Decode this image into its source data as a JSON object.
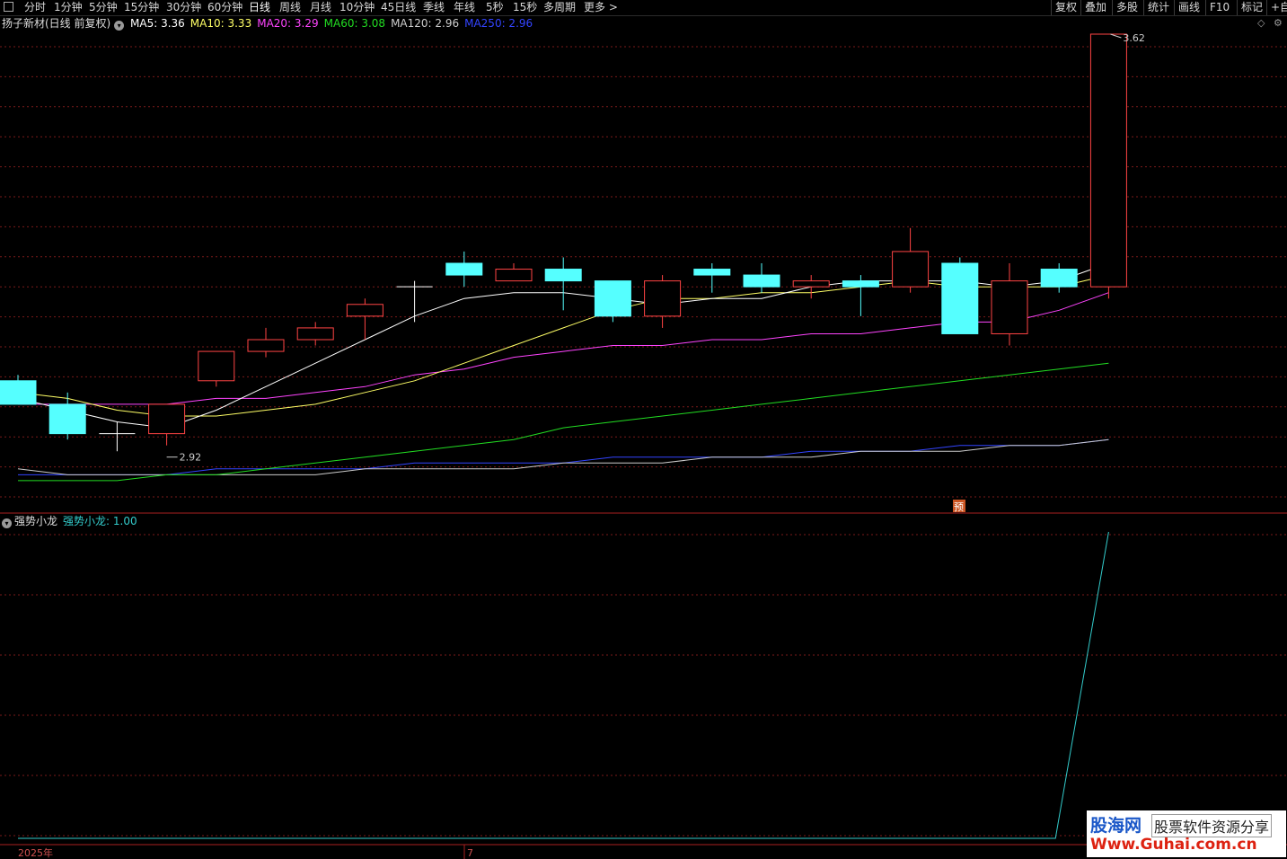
{
  "toolbar": {
    "periods": [
      "分时",
      "1分钟",
      "5分钟",
      "15分钟",
      "30分钟",
      "60分钟",
      "日线",
      "周线",
      "月线",
      "10分钟",
      "45日线",
      "季线",
      "年线",
      "5秒",
      "15秒",
      "多周期",
      "更多 >"
    ],
    "active": "日线",
    "right": [
      "复权",
      "叠加",
      "多股",
      "统计",
      "画线",
      "F10",
      "标记",
      "+自"
    ]
  },
  "main_legend": {
    "title": "扬子新材(日线 前复权)",
    "ma": [
      {
        "label": "MA5: 3.36",
        "color": "#ffffff"
      },
      {
        "label": "MA10: 3.33",
        "color": "#ffff66"
      },
      {
        "label": "MA20: 3.29",
        "color": "#ff44ff"
      },
      {
        "label": "MA60: 3.08",
        "color": "#22dd22"
      },
      {
        "label": "MA120: 2.96",
        "color": "#cccccc"
      },
      {
        "label": "MA250: 2.96",
        "color": "#3344ff"
      }
    ]
  },
  "indicator_legend": {
    "title": "强势小龙",
    "value_label": "强势小龙: 1.00",
    "value_color": "#33cccc"
  },
  "annotations": {
    "high": "3.62",
    "low": "2.92",
    "badge": "预"
  },
  "x_axis": {
    "labels": [
      "2025年",
      "7"
    ]
  },
  "watermark": {
    "brand": "股海网",
    "slogan": "股票软件资源分享",
    "url": "Www.Guhai.com.cn"
  },
  "colors": {
    "up": "#ff4444",
    "down": "#55ffff",
    "grid": "#7a1a1a",
    "axis": "#aa2020"
  },
  "chart_data": {
    "type": "candlestick",
    "candles": [
      {
        "o": 3.03,
        "h": 3.04,
        "l": 2.99,
        "c": 2.99
      },
      {
        "o": 2.99,
        "h": 3.01,
        "l": 2.93,
        "c": 2.94
      },
      {
        "o": 2.94,
        "h": 2.96,
        "l": 2.91,
        "c": 2.94
      },
      {
        "o": 2.94,
        "h": 2.99,
        "l": 2.92,
        "c": 2.99
      },
      {
        "o": 3.03,
        "h": 3.08,
        "l": 3.02,
        "c": 3.08
      },
      {
        "o": 3.08,
        "h": 3.12,
        "l": 3.07,
        "c": 3.1
      },
      {
        "o": 3.1,
        "h": 3.13,
        "l": 3.09,
        "c": 3.12
      },
      {
        "o": 3.14,
        "h": 3.17,
        "l": 3.1,
        "c": 3.16
      },
      {
        "o": 3.19,
        "h": 3.2,
        "l": 3.13,
        "c": 3.19
      },
      {
        "o": 3.23,
        "h": 3.25,
        "l": 3.19,
        "c": 3.21
      },
      {
        "o": 3.2,
        "h": 3.23,
        "l": 3.2,
        "c": 3.22
      },
      {
        "o": 3.22,
        "h": 3.24,
        "l": 3.15,
        "c": 3.2
      },
      {
        "o": 3.2,
        "h": 3.2,
        "l": 3.13,
        "c": 3.14
      },
      {
        "o": 3.14,
        "h": 3.21,
        "l": 3.12,
        "c": 3.2
      },
      {
        "o": 3.22,
        "h": 3.23,
        "l": 3.18,
        "c": 3.21
      },
      {
        "o": 3.21,
        "h": 3.23,
        "l": 3.18,
        "c": 3.19
      },
      {
        "o": 3.19,
        "h": 3.21,
        "l": 3.17,
        "c": 3.2
      },
      {
        "o": 3.2,
        "h": 3.21,
        "l": 3.14,
        "c": 3.19
      },
      {
        "o": 3.19,
        "h": 3.29,
        "l": 3.18,
        "c": 3.25
      },
      {
        "o": 3.23,
        "h": 3.24,
        "l": 3.11,
        "c": 3.11
      },
      {
        "o": 3.11,
        "h": 3.23,
        "l": 3.09,
        "c": 3.2
      },
      {
        "o": 3.22,
        "h": 3.23,
        "l": 3.18,
        "c": 3.19
      },
      {
        "o": 3.19,
        "h": 3.62,
        "l": 3.17,
        "c": 3.62
      }
    ],
    "ma5": [
      3.0,
      2.98,
      2.96,
      2.95,
      2.98,
      3.02,
      3.06,
      3.1,
      3.14,
      3.17,
      3.18,
      3.18,
      3.17,
      3.16,
      3.17,
      3.17,
      3.19,
      3.2,
      3.2,
      3.2,
      3.19,
      3.2,
      3.23
    ],
    "ma10": [
      3.01,
      3.0,
      2.98,
      2.97,
      2.97,
      2.98,
      2.99,
      3.01,
      3.03,
      3.06,
      3.09,
      3.12,
      3.15,
      3.17,
      3.17,
      3.18,
      3.18,
      3.19,
      3.2,
      3.19,
      3.19,
      3.19,
      3.21
    ],
    "ma20": [
      2.99,
      2.99,
      2.99,
      2.99,
      3.0,
      3.0,
      3.01,
      3.02,
      3.04,
      3.05,
      3.07,
      3.08,
      3.09,
      3.09,
      3.1,
      3.1,
      3.11,
      3.11,
      3.12,
      3.13,
      3.13,
      3.15,
      3.18
    ],
    "ma60": [
      2.86,
      2.86,
      2.86,
      2.87,
      2.87,
      2.88,
      2.89,
      2.9,
      2.91,
      2.92,
      2.93,
      2.95,
      2.96,
      2.97,
      2.98,
      2.99,
      3.0,
      3.01,
      3.02,
      3.03,
      3.04,
      3.05,
      3.06
    ],
    "ma120": [
      2.88,
      2.87,
      2.87,
      2.87,
      2.87,
      2.87,
      2.87,
      2.88,
      2.88,
      2.88,
      2.88,
      2.89,
      2.89,
      2.89,
      2.9,
      2.9,
      2.9,
      2.91,
      2.91,
      2.91,
      2.92,
      2.92,
      2.93
    ],
    "ma250": [
      2.87,
      2.87,
      2.87,
      2.87,
      2.88,
      2.88,
      2.88,
      2.88,
      2.89,
      2.89,
      2.89,
      2.89,
      2.9,
      2.9,
      2.9,
      2.9,
      2.91,
      2.91,
      2.91,
      2.92,
      2.92,
      2.92,
      2.93
    ],
    "indicator": [
      0,
      0,
      0,
      0,
      0,
      0,
      0,
      0,
      0,
      0,
      0,
      0,
      0,
      0,
      0,
      0,
      0,
      0,
      0,
      0,
      0,
      0,
      1
    ]
  }
}
